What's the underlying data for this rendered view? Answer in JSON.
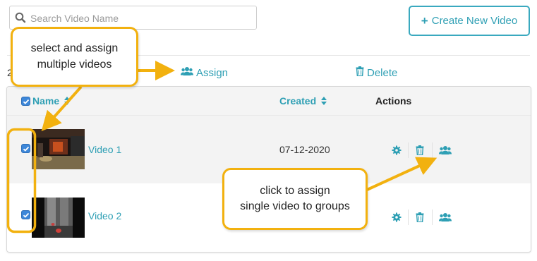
{
  "search": {
    "placeholder": "Search Video Name"
  },
  "toolbar": {
    "create_label": "Create New Video"
  },
  "bulk": {
    "count": "2",
    "assign_label": "Assign",
    "delete_label": "Delete"
  },
  "table": {
    "headers": {
      "name": "Name",
      "created": "Created",
      "actions": "Actions"
    },
    "rows": [
      {
        "name": "Video 1",
        "created": "07-12-2020",
        "selected": true
      },
      {
        "name": "Video 2",
        "created": "",
        "selected": true
      }
    ]
  },
  "callouts": {
    "multi": {
      "line1": "select and assign",
      "line2": "multiple videos"
    },
    "single": {
      "line1": "click to assign",
      "line2": "single video to groups"
    }
  },
  "colors": {
    "accent": "#2e9fb4",
    "callout_border": "#f2b10f",
    "checkbox": "#3d87d9"
  },
  "icons": [
    "search-icon",
    "plus-icon",
    "users-icon",
    "trash-icon",
    "gear-icon",
    "sort-icon",
    "checkbox-checked-icon"
  ]
}
